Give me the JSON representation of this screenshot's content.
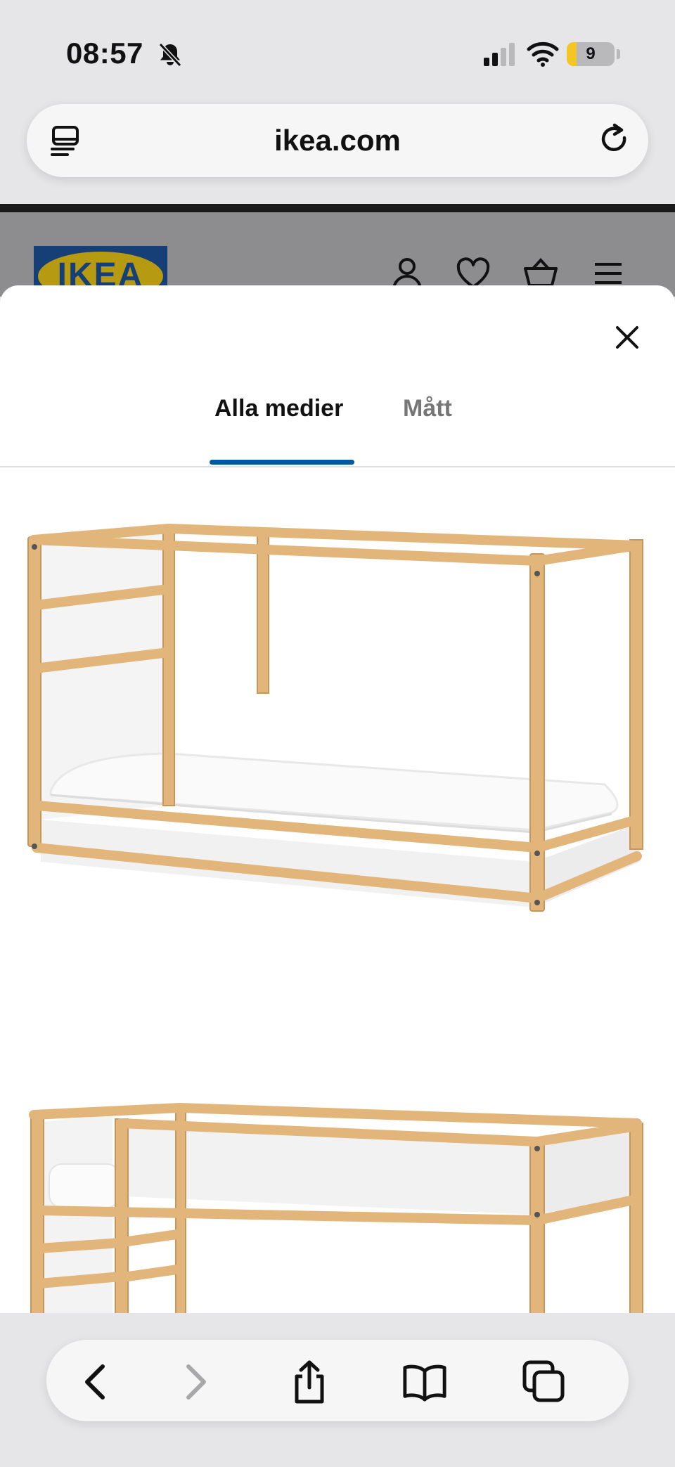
{
  "status_bar": {
    "time": "08:57",
    "battery_level": "9",
    "icons": [
      "bell-slash-icon",
      "cellular-signal-icon",
      "wifi-icon",
      "battery-icon"
    ]
  },
  "browser": {
    "url": "ikea.com",
    "reader_icon": "reader-view-icon",
    "reload_icon": "reload-icon"
  },
  "page_header": {
    "logo_text": "IKEA",
    "icons": [
      "account-icon",
      "favorites-heart-icon",
      "cart-icon",
      "menu-icon"
    ]
  },
  "modal": {
    "close_icon": "close-icon",
    "tabs": [
      {
        "label": "Alla medier",
        "selected": true
      },
      {
        "label": "Mått",
        "selected": false
      }
    ],
    "media": [
      {
        "name": "bed-low-position-image"
      },
      {
        "name": "bed-loft-position-image"
      }
    ]
  },
  "toolbar": {
    "icons": [
      "back-icon",
      "forward-icon",
      "share-icon",
      "bookmarks-icon",
      "tabs-icon"
    ],
    "forward_enabled": false
  },
  "colors": {
    "accent_blue": "#0058a3",
    "ikea_blue": "#0058a3",
    "ikea_yellow": "#ffdb00",
    "wood": "#e2b57a"
  }
}
